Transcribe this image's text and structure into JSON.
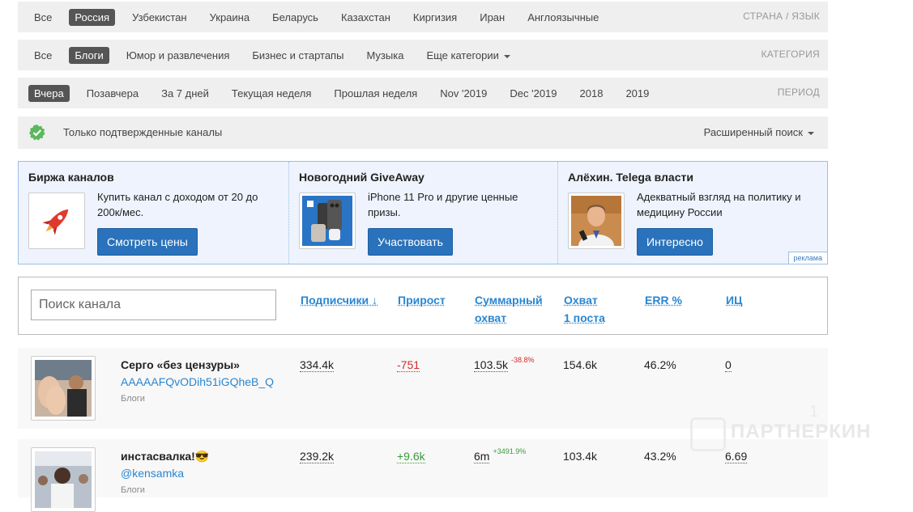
{
  "country_bar": {
    "items": [
      "Все",
      "Россия",
      "Узбекистан",
      "Украина",
      "Беларусь",
      "Казахстан",
      "Киргизия",
      "Иран",
      "Англоязычные"
    ],
    "active_index": 1,
    "label": "СТРАНА / ЯЗЫК"
  },
  "category_bar": {
    "items": [
      "Все",
      "Блоги",
      "Юмор и развлечения",
      "Бизнес и стартапы",
      "Музыка",
      "Еще категории"
    ],
    "active_index": 1,
    "label": "КАТЕГОРИЯ"
  },
  "period_bar": {
    "items": [
      "Вчера",
      "Позавчера",
      "За 7 дней",
      "Текущая неделя",
      "Прошлая неделя",
      "Nov '2019",
      "Dec '2019",
      "2018",
      "2019"
    ],
    "active_index": 0,
    "label": "ПЕРИОД"
  },
  "verified": {
    "text": "Только подтвержденные каналы",
    "advanced_search": "Расширенный поиск",
    "icon": "check-circle-icon",
    "color": "#5cb85c"
  },
  "ads": [
    {
      "title": "Биржа каналов",
      "desc": "Купить канал с доходом от 20 до 200к/мес.",
      "button": "Смотреть цены",
      "icon": "rocket-icon"
    },
    {
      "title": "Новогодний GiveAway",
      "desc": "iPhone 11 Pro и другие ценные призы.",
      "button": "Участвовать",
      "icon": "iphone-icon"
    },
    {
      "title": "Алёхин. Telega власти",
      "desc": "Адекватный взгляд на политику и медицину России",
      "button": "Интересно",
      "icon": "person-photo-icon"
    }
  ],
  "ad_badge": "реклама",
  "table": {
    "search_placeholder": "Поиск канала",
    "columns": {
      "subscribers": "Подписчики ↓",
      "growth": "Прирост",
      "total_reach_1": "Суммарный",
      "total_reach_2": "охват",
      "reach_1": "Охват",
      "reach_2": "1 поста",
      "err": "ERR %",
      "ic": "ИЦ"
    }
  },
  "rows": [
    {
      "name": "Серго «без цензуры»",
      "handle": "AAAAAFQvODih51iGQheB_Q",
      "category": "Блоги",
      "subscribers": "334.4k",
      "growth": "-751",
      "growth_sign": "neg",
      "total_reach": "103.5k",
      "total_reach_change": "-38.8%",
      "reach": "154.6k",
      "err": "46.2%",
      "ic": "0"
    },
    {
      "name": "инстасвалка!😎",
      "handle": "@kensamka",
      "category": "Блоги",
      "subscribers": "239.2k",
      "growth": "+9.6k",
      "growth_sign": "pos",
      "total_reach": "6m",
      "total_reach_change": "+3491.9%",
      "reach": "103.4k",
      "err": "43.2%",
      "ic": "6.69"
    }
  ],
  "watermark": {
    "text": "ПАРТНЕРКИН",
    "number": "1"
  },
  "colors": {
    "accent": "#2a72bb",
    "link": "#2a86d0",
    "active_tab": "#555555",
    "negative": "#d12b2b",
    "positive": "#3a9a3a"
  }
}
